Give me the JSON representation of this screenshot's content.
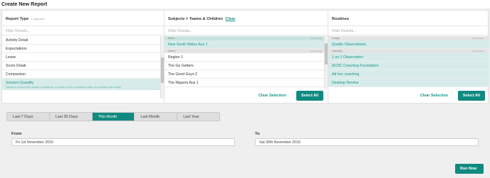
{
  "page": {
    "title": "Create New Report"
  },
  "report_type": {
    "heading": "Report Type",
    "selected_note": "1 selected",
    "filter_placeholder": "Filter Results...",
    "items": [
      {
        "label": "Activity Detail",
        "selected": false
      },
      {
        "label": "Expectations",
        "selected": false
      },
      {
        "label": "Leave",
        "selected": false
      },
      {
        "label": "Score Detail",
        "selected": false
      },
      {
        "label": "Comparison",
        "selected": false
      },
      {
        "label": "Session Quantity",
        "selected": true,
        "description": "Display a count of the number of sessions, or activity, in the completed, within the selected date range"
      }
    ]
  },
  "subjects": {
    "heading": "Subjects > Teams & Children",
    "clear_label": "Clear",
    "filter_placeholder": "Filter Results...",
    "groups": [
      {
        "label": "Direct",
        "select_group": "select group",
        "items": [
          {
            "label": "New South Wales Aus 1",
            "selected": true
          }
        ]
      },
      {
        "label": "Level 1",
        "select_group": "select group",
        "items": [
          {
            "label": "Region 1",
            "selected": false
          },
          {
            "label": "The Go Getters",
            "selected": false
          },
          {
            "label": "The Good Guys 2",
            "selected": false
          },
          {
            "label": "The Rippers Aus 1",
            "selected": false
          }
        ]
      }
    ],
    "clear_selection_label": "Clear Selection",
    "select_all_label": "Select All"
  },
  "routines": {
    "heading": "Routines",
    "filter_placeholder": "Filter Results...",
    "groups": [
      {
        "label": "Groups",
        "select_group": "select group",
        "items": [
          {
            "label": "Quality Observations",
            "selected": true
          }
        ]
      },
      {
        "label": "Coaching",
        "select_group": "select group",
        "items": [
          {
            "label": "1 on 1 Observation",
            "selected": true
          },
          {
            "label": "ACDC Coaching Foundation",
            "selected": true
          },
          {
            "label": "Ad hoc coaching",
            "selected": true
          },
          {
            "label": "Desktop Review",
            "selected": true
          }
        ]
      }
    ],
    "clear_selection_label": "Clear Selection",
    "select_all_label": "Select All"
  },
  "date_range": {
    "tabs": [
      {
        "label": "Last 7 Days",
        "active": false
      },
      {
        "label": "Last 30 Days",
        "active": false
      },
      {
        "label": "This Month",
        "active": true
      },
      {
        "label": "Last Month",
        "active": false
      },
      {
        "label": "Last Year",
        "active": false
      }
    ],
    "from_label": "From",
    "from_value": "Fri 1st November 2019",
    "to_label": "To",
    "to_value": "Sat 30th November 2019"
  },
  "actions": {
    "run_now_label": "Run Now"
  },
  "colors": {
    "accent": "#108a80",
    "selected_bg": "#d7ecea",
    "selected_text": "#17948a"
  }
}
